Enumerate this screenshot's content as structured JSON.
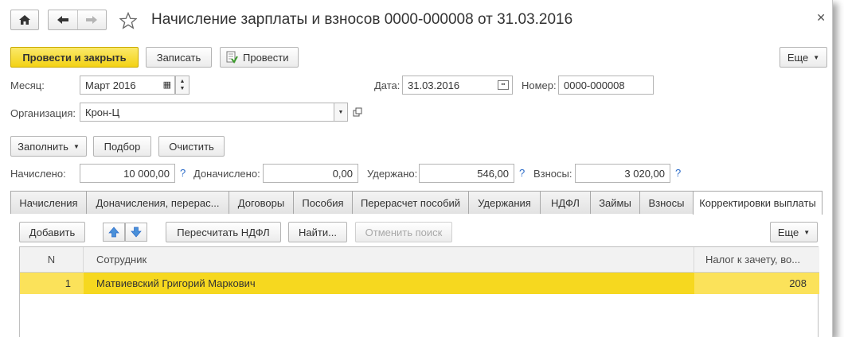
{
  "nav": {
    "home_icon": "home-icon",
    "back_icon": "arrow-left-icon",
    "forward_icon": "arrow-right-icon",
    "star_icon": "star-icon",
    "title": "Начисление зарплаты и взносов 0000-000008 от 31.03.2016",
    "close_icon": "close-icon"
  },
  "toolbar": {
    "post_close": "Провести и закрыть",
    "save": "Записать",
    "post": "Провести",
    "more": "Еще"
  },
  "form": {
    "month_label": "Месяц:",
    "month_value": "Март 2016",
    "date_label": "Дата:",
    "date_value": "31.03.2016",
    "number_label": "Номер:",
    "number_value": "0000-000008",
    "org_label": "Организация:",
    "org_value": "Крон-Ц"
  },
  "actions": {
    "fill": "Заполнить",
    "pick": "Подбор",
    "clear": "Очистить"
  },
  "totals": {
    "accrued_label": "Начислено:",
    "accrued_value": "10 000,00",
    "extra_label": "Доначислено:",
    "extra_value": "0,00",
    "withheld_label": "Удержано:",
    "withheld_value": "546,00",
    "contrib_label": "Взносы:",
    "contrib_value": "3 020,00",
    "help": "?"
  },
  "tabs": [
    {
      "label": "Начисления"
    },
    {
      "label": "Доначисления, перерас..."
    },
    {
      "label": "Договоры"
    },
    {
      "label": "Пособия"
    },
    {
      "label": "Перерасчет пособий"
    },
    {
      "label": "Удержания"
    },
    {
      "label": "НДФЛ"
    },
    {
      "label": "Займы"
    },
    {
      "label": "Взносы"
    },
    {
      "label": "Корректировки выплаты"
    }
  ],
  "table_toolbar": {
    "add": "Добавить",
    "recalc": "Пересчитать НДФЛ",
    "find": "Найти...",
    "cancel_search": "Отменить поиск",
    "more": "Еще"
  },
  "table": {
    "columns": [
      "N",
      "Сотрудник",
      "Налог к зачету, во..."
    ],
    "rows": [
      {
        "n": "1",
        "employee": "Матвиевский Григорий Маркович",
        "tax": "208"
      }
    ]
  }
}
